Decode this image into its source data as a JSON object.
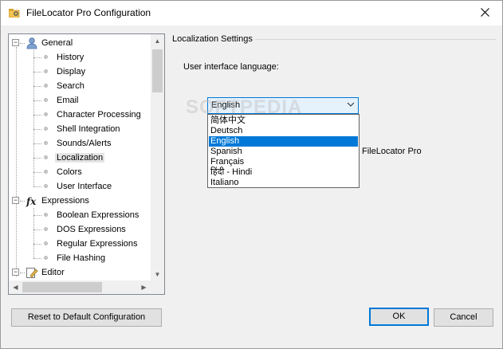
{
  "window": {
    "title": "FileLocator Pro Configuration",
    "icon": "folder-search-icon"
  },
  "tree": {
    "items": [
      {
        "label": "General",
        "level": 0,
        "icon": "user-icon"
      },
      {
        "label": "History",
        "level": 1
      },
      {
        "label": "Display",
        "level": 1
      },
      {
        "label": "Search",
        "level": 1
      },
      {
        "label": "Email",
        "level": 1
      },
      {
        "label": "Character Processing",
        "level": 1
      },
      {
        "label": "Shell Integration",
        "level": 1
      },
      {
        "label": "Sounds/Alerts",
        "level": 1
      },
      {
        "label": "Localization",
        "level": 1,
        "selected": true
      },
      {
        "label": "Colors",
        "level": 1
      },
      {
        "label": "User Interface",
        "level": 1
      },
      {
        "label": "Expressions",
        "level": 0,
        "icon": "fx-icon"
      },
      {
        "label": "Boolean Expressions",
        "level": 1
      },
      {
        "label": "DOS Expressions",
        "level": 1
      },
      {
        "label": "Regular Expressions",
        "level": 1
      },
      {
        "label": "File Hashing",
        "level": 1
      },
      {
        "label": "Editor",
        "level": 0,
        "icon": "editor-icon"
      }
    ]
  },
  "localization": {
    "section_title": "Localization Settings",
    "language_label": "User interface language:",
    "selected_language": "English",
    "options": [
      "简体中文",
      "Deutsch",
      "English",
      "Spanish",
      "Français",
      "हिंदी - Hindi",
      "Italiano"
    ],
    "partial_text": "FileLocator Pro"
  },
  "watermark": "SOFTPEDIA",
  "buttons": {
    "reset": "Reset to Default Configuration",
    "ok": "OK",
    "cancel": "Cancel"
  },
  "colors": {
    "accent": "#0078d7",
    "selection_bg": "#0078d7"
  }
}
